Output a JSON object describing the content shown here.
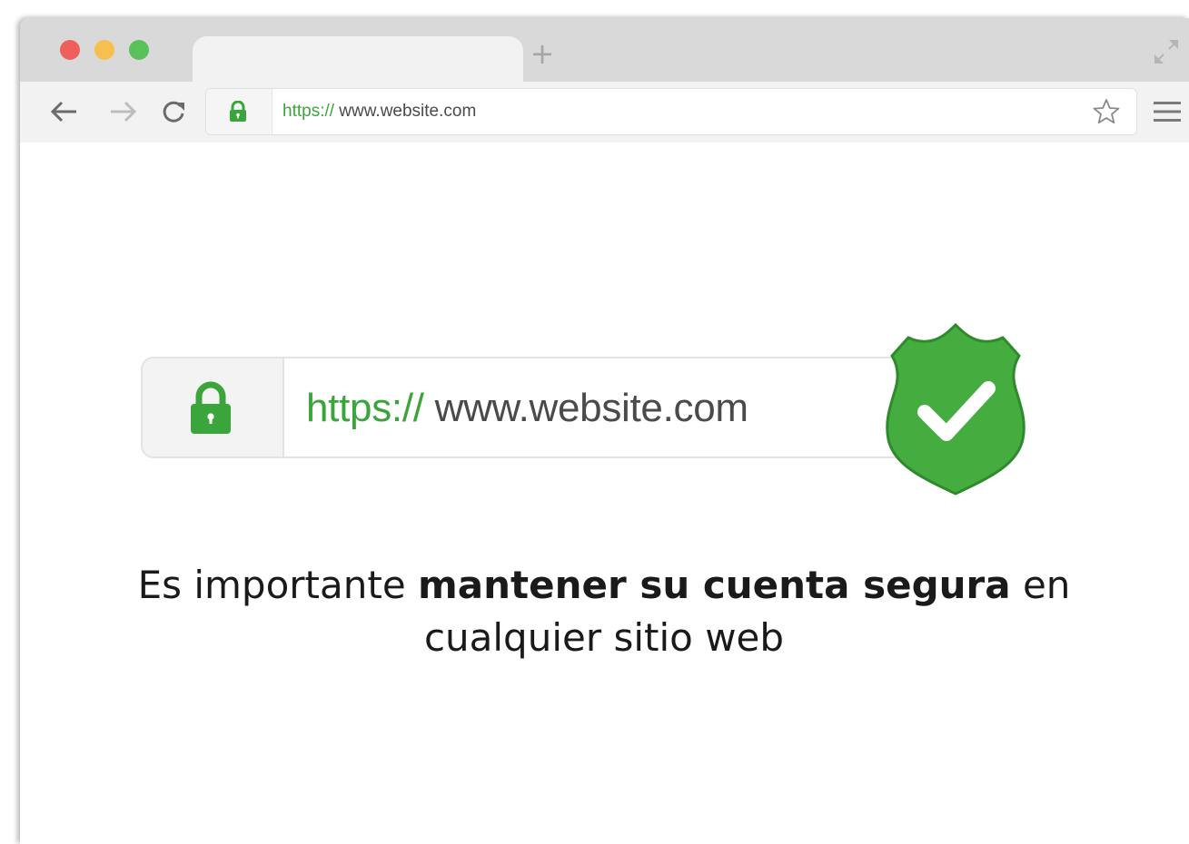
{
  "browser": {
    "new_tab_label": "+",
    "address": {
      "scheme": "https://",
      "host": " www.website.com"
    }
  },
  "hero": {
    "scheme": "https://",
    "host": " www.website.com"
  },
  "caption": {
    "part1": "Es importante ",
    "bold": "mantener su cuenta segura",
    "part2": " en cualquier sitio web"
  },
  "colors": {
    "secure_green": "#3aa53a",
    "shield_green": "#45ad3f",
    "close_dot": "#f0605a",
    "minimize_dot": "#f5c04e",
    "maximize_dot": "#5ac05a"
  },
  "icons": {
    "lock": "lock-icon",
    "shield": "shield-check-icon",
    "back": "arrow-left-icon",
    "forward": "arrow-right-icon",
    "reload": "reload-icon",
    "bookmark": "star-icon",
    "menu": "hamburger-icon",
    "fullscreen": "expand-icon"
  }
}
